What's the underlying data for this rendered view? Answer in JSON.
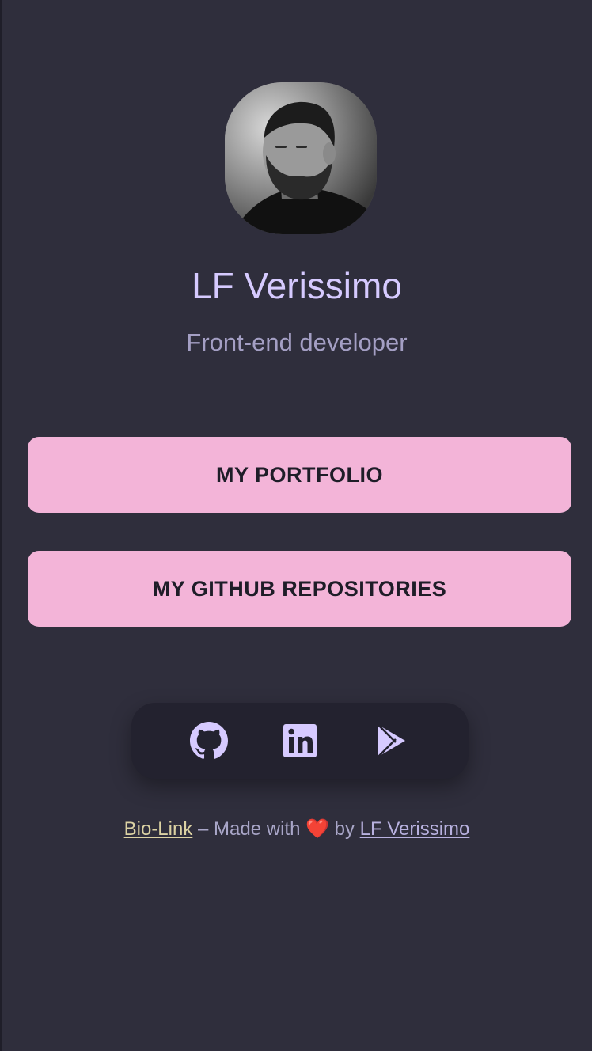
{
  "profile": {
    "name": "LF Verissimo",
    "subtitle": "Front-end developer"
  },
  "links": [
    {
      "label": "MY PORTFOLIO"
    },
    {
      "label": "MY GITHUB REPOSITORIES"
    }
  ],
  "socials": [
    {
      "icon": "github-icon"
    },
    {
      "icon": "linkedin-icon"
    },
    {
      "icon": "google-play-icon"
    }
  ],
  "footer": {
    "bio_link": "Bio-Link",
    "made_with": " – Made with ",
    "heart": "❤️",
    "by": " by ",
    "author": "LF Verissimo"
  },
  "colors": {
    "background": "#2f2e3c",
    "accent": "#d6caff",
    "button": "#f3b4d8",
    "social_bar": "#23222f"
  }
}
